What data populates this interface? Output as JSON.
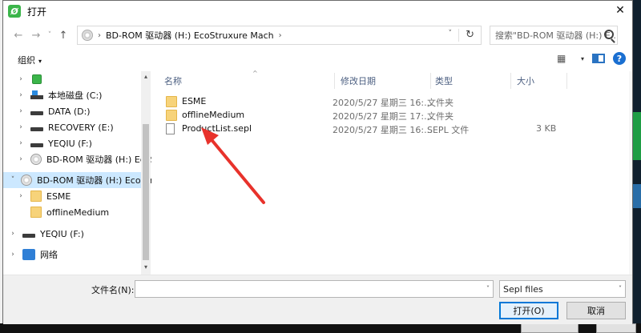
{
  "window": {
    "title": "打开",
    "app_icon_glyph": "Ø",
    "close_glyph": "✕"
  },
  "nav": {
    "back": "←",
    "forward": "→",
    "recent": "˅",
    "up": "↑"
  },
  "address": {
    "sep": "›",
    "crumb": "BD-ROM 驱动器 (H:) EcoStruxure Mach",
    "refresh": "↻",
    "dropdown": "˅"
  },
  "search": {
    "placeholder": "搜索\"BD-ROM 驱动器 (H:) E..."
  },
  "toolbar": {
    "organize": "组织",
    "caret": "▾",
    "view_glyph": "▦",
    "help": "?"
  },
  "sidebar": {
    "items": [
      {
        "label": "",
        "expander": "›",
        "icon": "green-app-icon"
      },
      {
        "label": "本地磁盘 (C:)",
        "expander": "›",
        "icon": "windows-drive-icon"
      },
      {
        "label": "DATA (D:)",
        "expander": "›",
        "icon": "drive-icon"
      },
      {
        "label": "RECOVERY (E:)",
        "expander": "›",
        "icon": "drive-icon"
      },
      {
        "label": "YEQIU (F:)",
        "expander": "›",
        "icon": "drive-icon"
      },
      {
        "label": "BD-ROM 驱动器 (H:) EcoS",
        "expander": "›",
        "icon": "cd-drive-icon"
      },
      {
        "label": "BD-ROM 驱动器 (H:) EcoStr",
        "expander": "˅",
        "icon": "cd-drive-icon",
        "selected": true
      },
      {
        "label": "ESME",
        "expander": "›",
        "icon": "folder-icon"
      },
      {
        "label": "offlineMedium",
        "expander": "",
        "icon": "folder-icon"
      },
      {
        "label": "YEQIU (F:)",
        "expander": "›",
        "icon": "drive-icon"
      },
      {
        "label": "网络",
        "expander": "›",
        "icon": "network-icon"
      }
    ],
    "scroll_up": "▴",
    "scroll_down": "▾"
  },
  "columns": {
    "name": "名称",
    "date": "修改日期",
    "type": "类型",
    "size": "大小",
    "sort_glyph": "^"
  },
  "files": [
    {
      "name": "ESME",
      "date": "2020/5/27 星期三 16:...",
      "type": "文件夹",
      "size": "",
      "icon": "folder-icon"
    },
    {
      "name": "offlineMedium",
      "date": "2020/5/27 星期三 17:...",
      "type": "文件夹",
      "size": "",
      "icon": "folder-icon"
    },
    {
      "name": "ProductList.sepl",
      "date": "2020/5/27 星期三 16:...",
      "type": "SEPL 文件",
      "size": "3 KB",
      "icon": "file-icon"
    }
  ],
  "bottom": {
    "filename_label": "文件名(N):",
    "filename_value": "",
    "filter_value": "Sepl files",
    "dropdown": "˅",
    "open_label": "打开(O)",
    "cancel_label": "取消"
  },
  "colors": {
    "accent": "#0078d7",
    "selection": "#cce8ff",
    "annotation_arrow": "#e8322b"
  }
}
